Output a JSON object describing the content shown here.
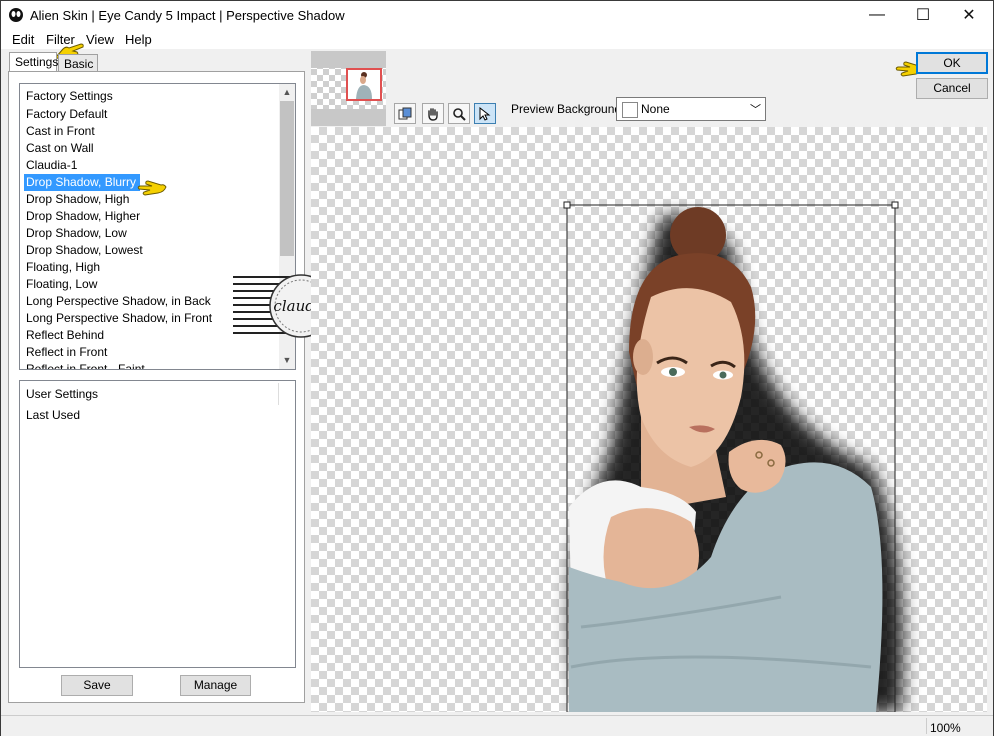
{
  "window": {
    "title": "Alien Skin | Eye Candy 5 Impact | Perspective Shadow",
    "minimize": "—",
    "maximize": "☐",
    "close": "✕"
  },
  "menu": [
    "Edit",
    "Filter",
    "View",
    "Help"
  ],
  "tabs": {
    "settings": "Settings",
    "basic": "Basic"
  },
  "factory": {
    "header": "Factory Settings",
    "items": [
      "Factory Default",
      "Cast in Front",
      "Cast on Wall",
      "Claudia-1",
      "Drop Shadow, Blurry",
      "Drop Shadow, High",
      "Drop Shadow, Higher",
      "Drop Shadow, Low",
      "Drop Shadow, Lowest",
      "Floating, High",
      "Floating, Low",
      "Long Perspective Shadow, in Back",
      "Long Perspective Shadow, in Front",
      "Reflect Behind",
      "Reflect in Front",
      "Reflect in Front - Faint"
    ],
    "selected_index": 4
  },
  "user": {
    "header": "User Settings",
    "items": [
      "Last Used"
    ]
  },
  "buttons": {
    "save": "Save",
    "manage": "Manage",
    "ok": "OK",
    "cancel": "Cancel"
  },
  "preview": {
    "background_label": "Preview Background:",
    "background_value": "None"
  },
  "watermark": {
    "text": "claudia"
  },
  "status": {
    "zoom": "100%"
  },
  "colors": {
    "selection": "#3399ff",
    "pointer_hand": "#f5d000"
  }
}
